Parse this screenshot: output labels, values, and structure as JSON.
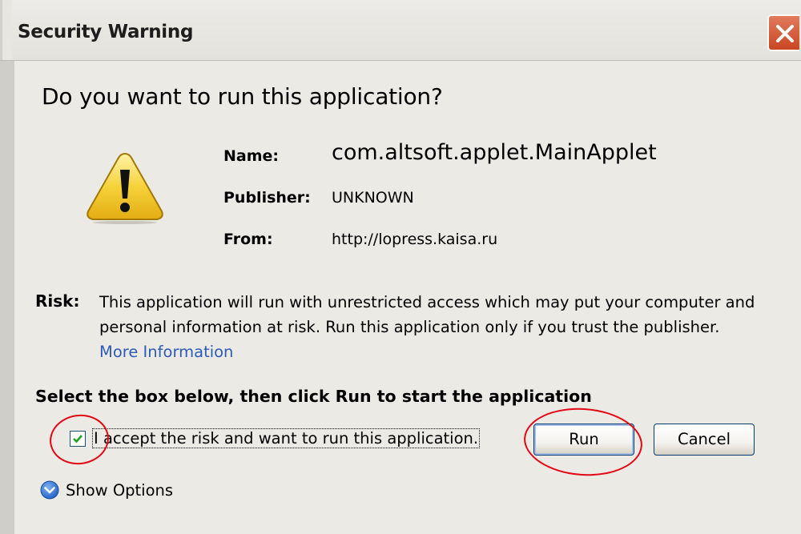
{
  "dialog": {
    "title": "Security Warning",
    "question": "Do you want to run this application?"
  },
  "details": {
    "name_label": "Name:",
    "name_value": "com.altsoft.applet.MainApplet",
    "publisher_label": "Publisher:",
    "publisher_value": "UNKNOWN",
    "from_label": "From:",
    "from_value": "http://lopress.kaisa.ru"
  },
  "risk": {
    "label": "Risk:",
    "text": "This application will run with unrestricted access which may put your computer and personal information at risk. Run this application only if you trust the publisher.",
    "more_info_link": "More Information"
  },
  "instruction": "Select the box below, then click Run to start the application",
  "accept": {
    "checked": true,
    "label": "I accept the risk and want to run this application."
  },
  "buttons": {
    "run": "Run",
    "cancel": "Cancel"
  },
  "show_options": "Show Options",
  "icons": {
    "warning": "warning-icon",
    "close": "close-icon",
    "expand": "chevron-down-circle-icon",
    "check": "check-icon"
  },
  "colors": {
    "link": "#2c5bb8",
    "close_button": "#c94622",
    "annotation_circle": "#e30613",
    "warning_fill": "#f6d23a"
  }
}
